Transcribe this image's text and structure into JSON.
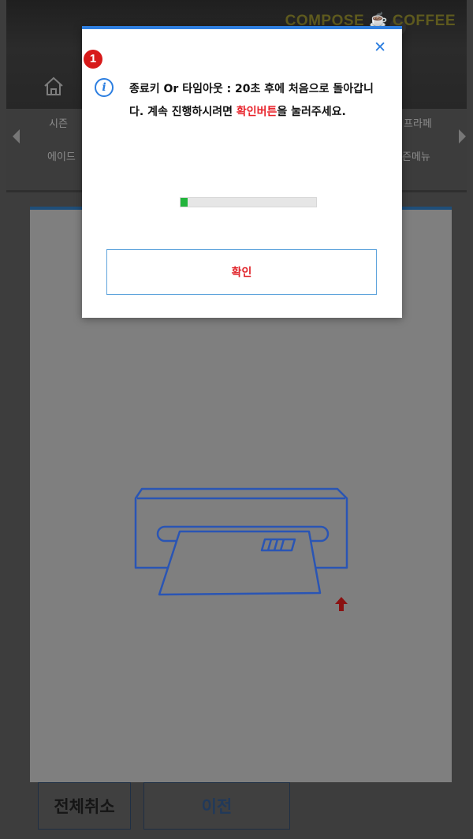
{
  "header": {
    "brand": "COMPOSE ☕ COFFEE"
  },
  "categories": {
    "row1_left": "시즌",
    "row1_right": "프라페",
    "row2_left": "에이드",
    "row2_right": "즌메뉴"
  },
  "bottom_buttons": {
    "cancel_all": "전체취소",
    "previous": "이전"
  },
  "modal": {
    "close_symbol": "✕",
    "info_symbol": "i",
    "message_before": "종료키 Or 타임아웃 : 20초 후에 처음으로 돌아갑니다. 계속 진행하시려면 ",
    "message_highlight": "확인버튼",
    "message_after": "을 눌러주세요.",
    "progress_fraction": 0.05,
    "confirm_label": "확인"
  },
  "annotation": {
    "step_number": "1"
  },
  "icons": {
    "home": "home-icon",
    "close": "close-icon",
    "info": "info-icon",
    "card_reader": "card-reader-icon",
    "insert_arrow": "up-arrow-icon"
  },
  "colors": {
    "accent_blue": "#2c7ee0",
    "highlight_red": "#e8232b",
    "progress_green": "#22b43c",
    "badge_red": "#d71a1a"
  }
}
